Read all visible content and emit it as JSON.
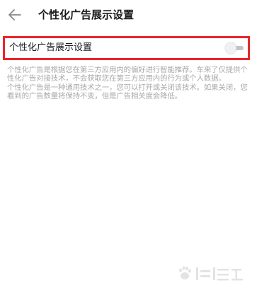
{
  "header": {
    "title": "个性化广告展示设置",
    "back_icon": "arrow-left-icon"
  },
  "setting": {
    "label": "个性化广告展示设置",
    "toggle_on": false
  },
  "description": {
    "paragraph_1": "个性化广告是根据您在第三方应用内的偏好进行智能推荐。车来了仅提供个性化广告对接技术，不会获取您在第三方应用内的行为或个人数据。",
    "paragraph_2": "个性化广告是一种通用技术之一，您可以打开或关闭该技术。如果关闭，您看到的广告数量将保持不变，但是广告相关度会降低。"
  },
  "colors": {
    "highlight_border": "#e8262b",
    "description_text": "#a9a9a9",
    "toggle_track": "#c4c4c4"
  }
}
